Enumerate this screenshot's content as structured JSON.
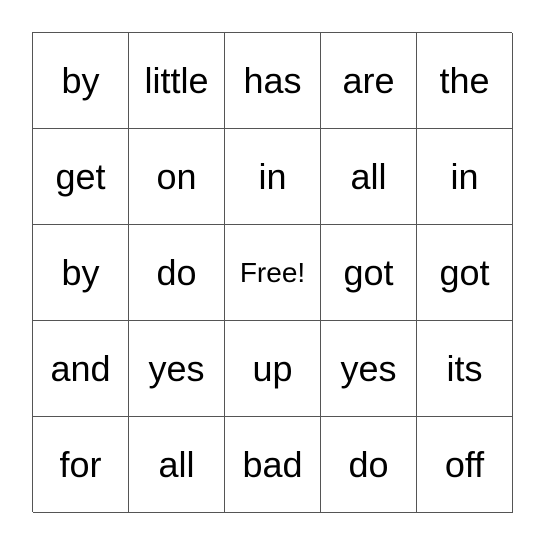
{
  "board": {
    "cells": [
      "by",
      "little",
      "has",
      "are",
      "the",
      "get",
      "on",
      "in",
      "all",
      "in",
      "by",
      "do",
      "Free!",
      "got",
      "got",
      "and",
      "yes",
      "up",
      "yes",
      "its",
      "for",
      "all",
      "bad",
      "do",
      "off"
    ]
  }
}
